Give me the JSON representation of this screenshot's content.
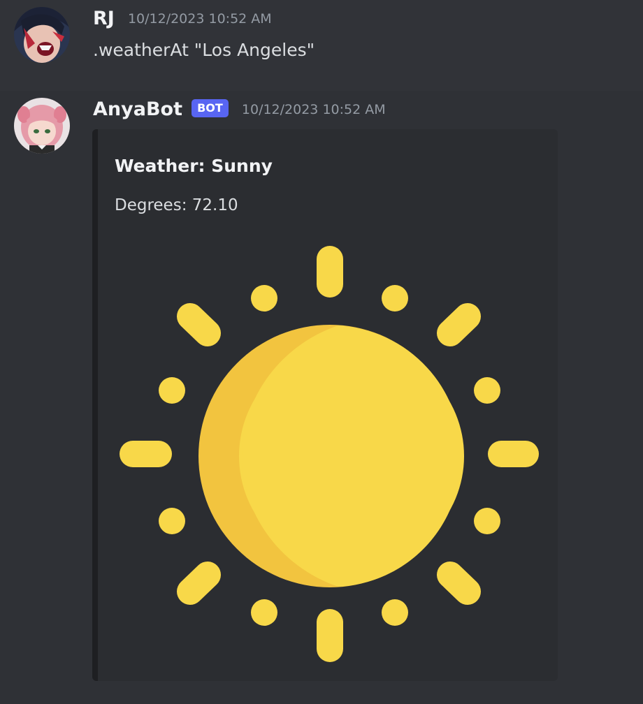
{
  "messages": [
    {
      "author": "RJ",
      "timestamp": "10/12/2023 10:52 AM",
      "content": ".weatherAt \"Los Angeles\"",
      "avatar_icon": "anime-avatar-icon"
    },
    {
      "author": "AnyaBot",
      "badge": "BOT",
      "timestamp": "10/12/2023 10:52 AM",
      "avatar_icon": "anya-avatar-icon",
      "embed": {
        "title": "Weather: Sunny",
        "description": "Degrees: 72.10",
        "image_icon": "sun-icon",
        "colors": {
          "sun_light": "#f8d849",
          "sun_shade": "#f2c43f",
          "rays": "#f8d849"
        }
      }
    }
  ],
  "theme": {
    "background": "#313338",
    "badge_color": "#5865f2"
  }
}
